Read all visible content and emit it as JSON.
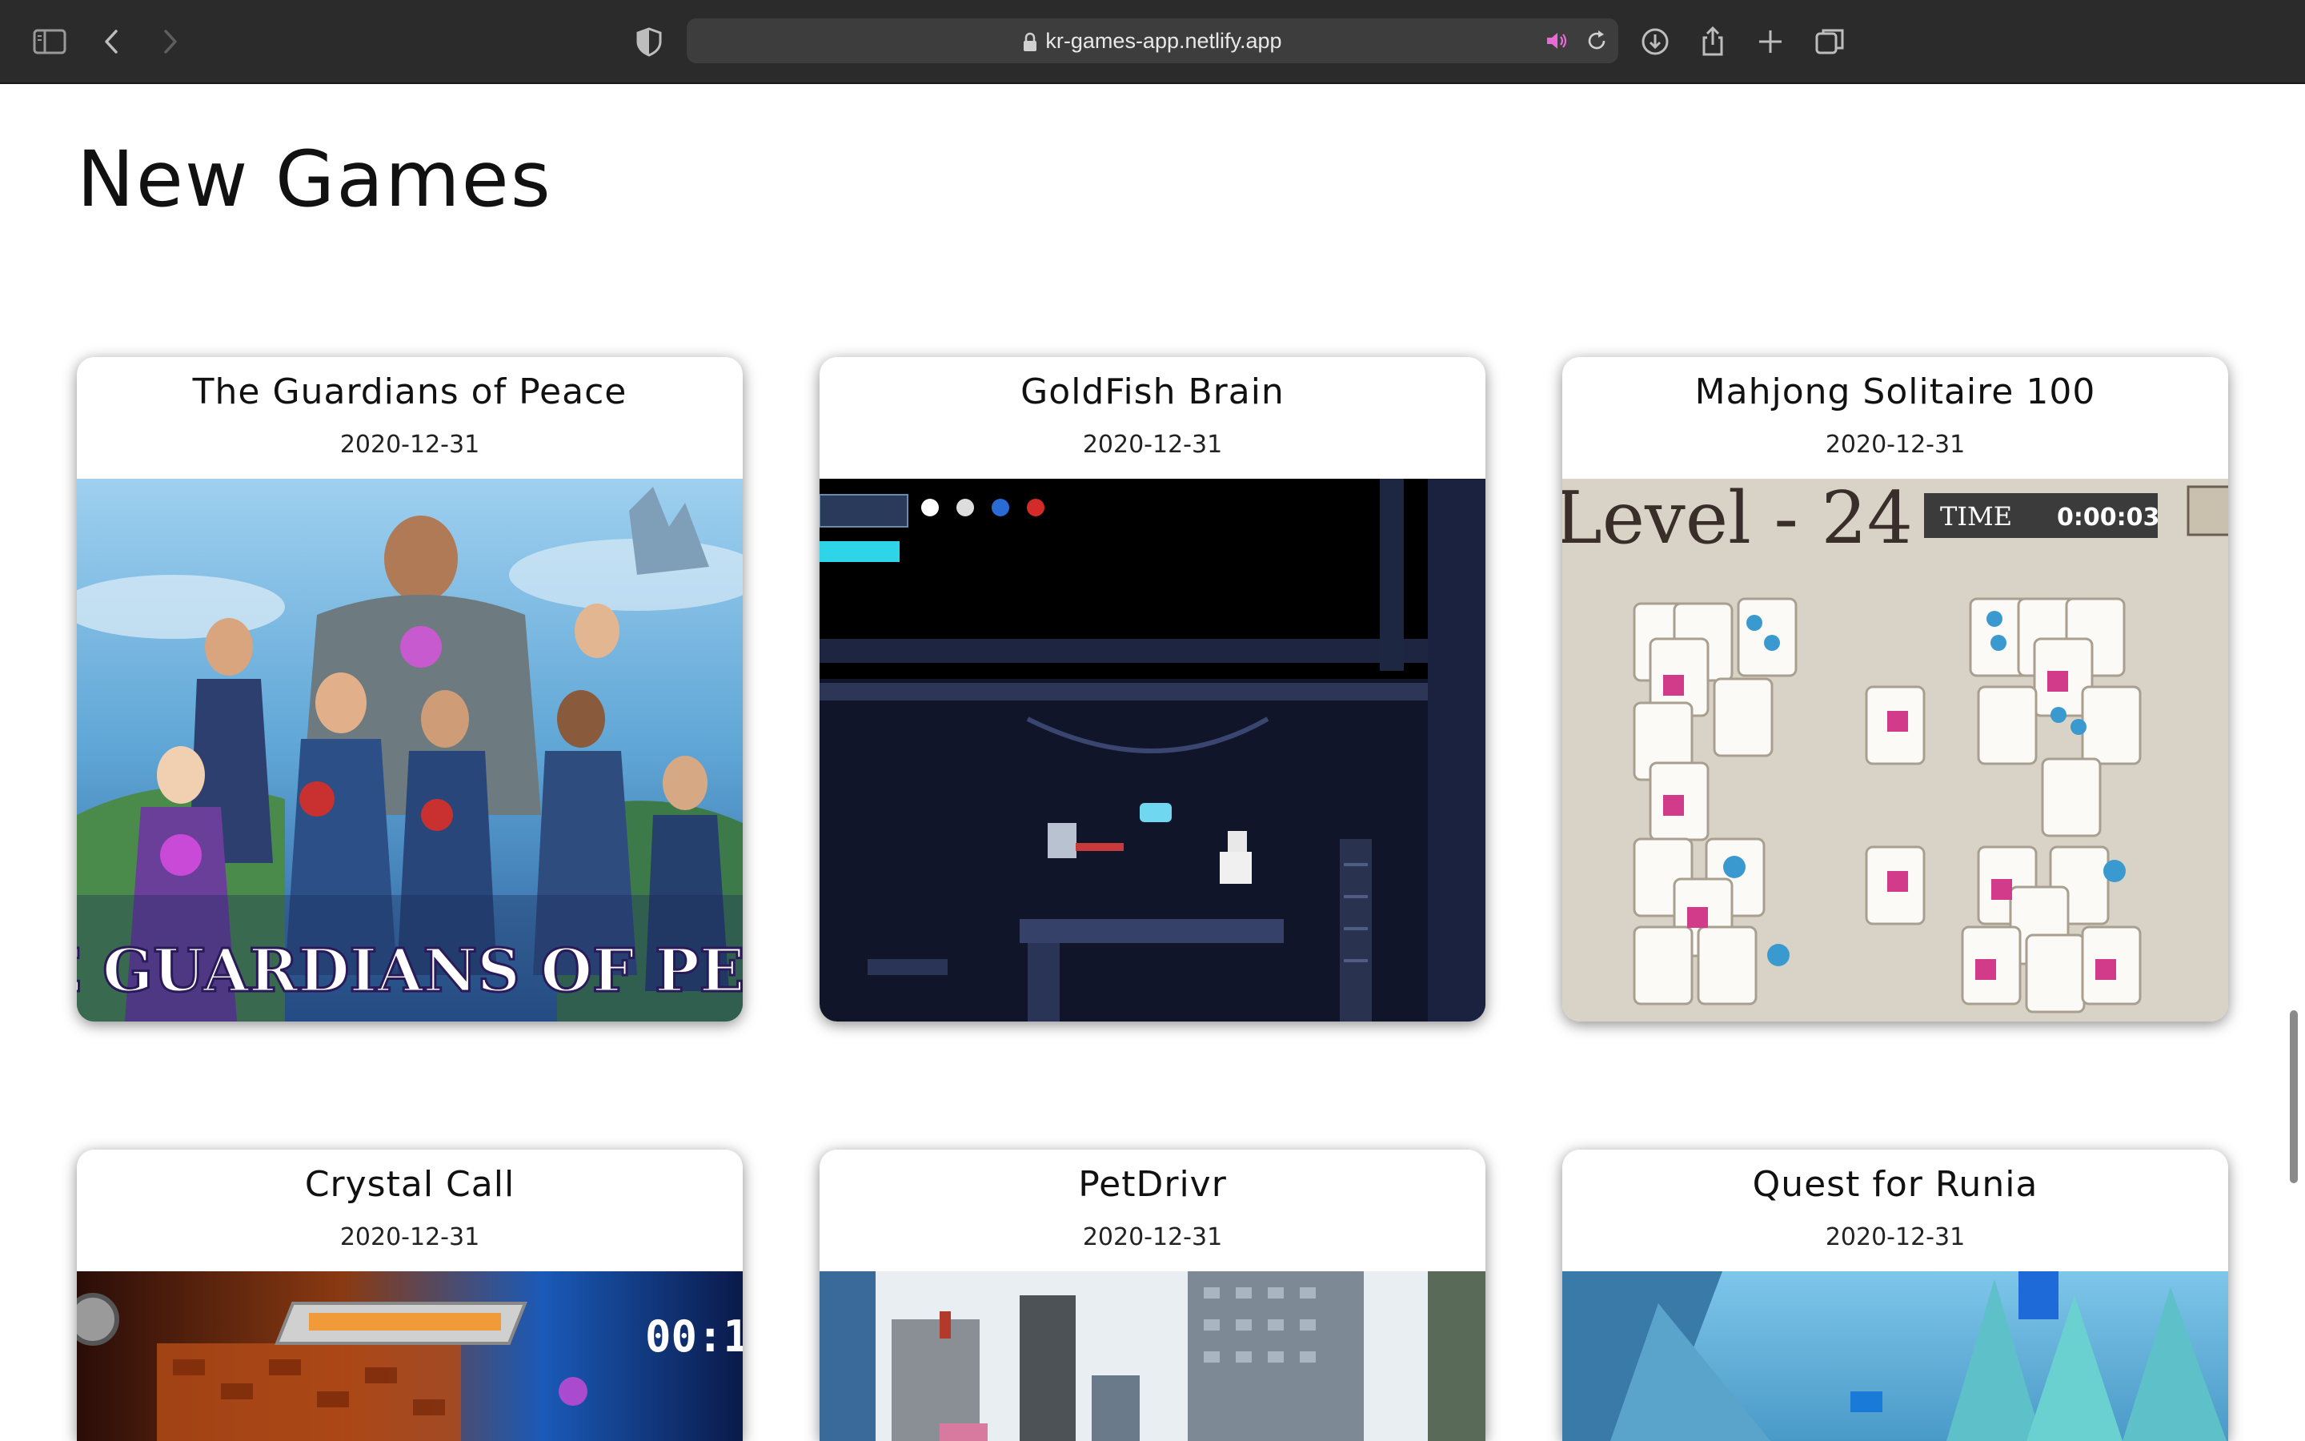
{
  "browser": {
    "url": "kr-games-app.netlify.app",
    "icons": [
      "sidebar-icon",
      "back-icon",
      "forward-icon",
      "shield-icon",
      "lock-icon",
      "speaker-icon",
      "reload-icon",
      "download-icon",
      "share-icon",
      "new-tab-icon",
      "tabs-overview-icon"
    ]
  },
  "page": {
    "title": "New Games"
  },
  "games": [
    {
      "title": "The Guardians of Peace",
      "date": "2020-12-31",
      "logo_text": "THE GUARDIANS OF PEACE"
    },
    {
      "title": "GoldFish Brain",
      "date": "2020-12-31"
    },
    {
      "title": "Mahjong Solitaire 100",
      "date": "2020-12-31",
      "level_text": "Level - 24",
      "time_label": "TIME",
      "time_value": "0:00:03"
    },
    {
      "title": "Crystal Call",
      "date": "2020-12-31",
      "timer_text": "00:1"
    },
    {
      "title": "PetDrivr",
      "date": "2020-12-31"
    },
    {
      "title": "Quest for Runia",
      "date": "2020-12-31"
    }
  ],
  "colors": {
    "toolbar": "#2b2b2b",
    "url_bar": "#3d3d3d",
    "accent_speaker": "#e86ad6"
  }
}
